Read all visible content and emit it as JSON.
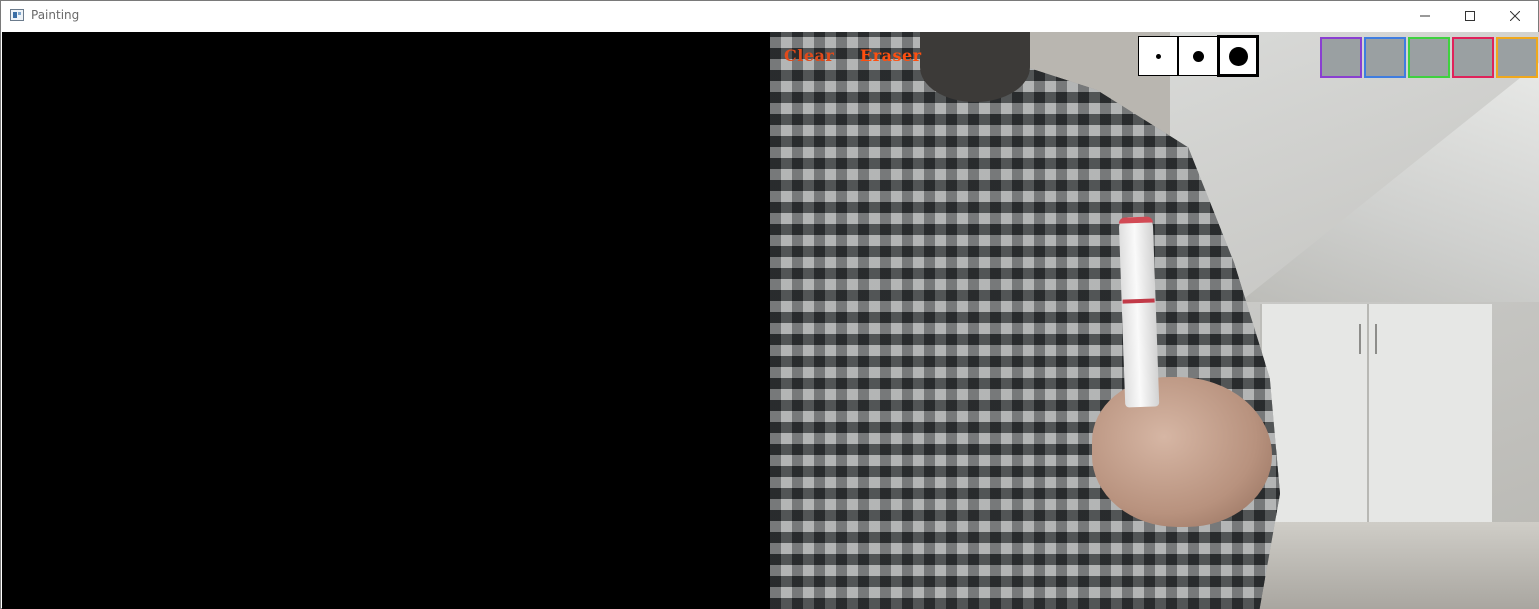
{
  "window": {
    "title": "Painting",
    "controls": {
      "minimize": "minimize-icon",
      "maximize": "maximize-icon",
      "close": "close-icon"
    }
  },
  "toolbar": {
    "clear_label": "Clear",
    "eraser_label": "Eraser",
    "brush_sizes": [
      {
        "name": "small",
        "selected": false
      },
      {
        "name": "medium",
        "selected": false
      },
      {
        "name": "large",
        "selected": true
      }
    ],
    "colors": [
      {
        "name": "purple",
        "hex": "#8a3fd1"
      },
      {
        "name": "blue",
        "hex": "#3f7de0"
      },
      {
        "name": "green",
        "hex": "#3fd13f"
      },
      {
        "name": "red",
        "hex": "#e0225a"
      },
      {
        "name": "orange",
        "hex": "#f0a81c"
      }
    ]
  },
  "panes": {
    "canvas_background": "#000000"
  }
}
